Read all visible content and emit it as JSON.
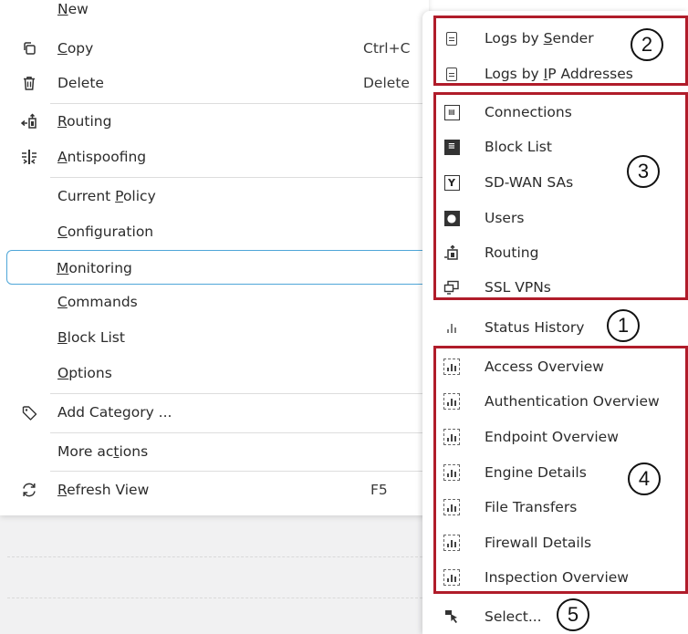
{
  "left_menu": {
    "new": {
      "pre": "",
      "ul": "N",
      "post": "ew"
    },
    "copy": {
      "pre": "",
      "ul": "C",
      "post": "opy",
      "shortcut": "Ctrl+C",
      "icon": "copy-icon"
    },
    "delete": {
      "label": "Delete",
      "shortcut": "Delete",
      "icon": "trash-icon"
    },
    "routing": {
      "pre": "",
      "ul": "R",
      "post": "outing",
      "icon": "routing-icon"
    },
    "antispoofing": {
      "pre": "",
      "ul": "A",
      "post": "ntispoofing",
      "icon": "antispoofing-icon"
    },
    "current_policy": {
      "pre": "Current ",
      "ul": "P",
      "post": "olicy"
    },
    "configuration": {
      "pre": "",
      "ul": "C",
      "post": "onfiguration"
    },
    "monitoring": {
      "pre": "",
      "ul": "M",
      "post": "onitoring"
    },
    "commands": {
      "pre": "",
      "ul": "C",
      "post": "ommands"
    },
    "block_list": {
      "pre": "",
      "ul": "B",
      "post": "lock List"
    },
    "options": {
      "pre": "",
      "ul": "O",
      "post": "ptions"
    },
    "add_category": {
      "label": "Add Category ...",
      "icon": "tag-icon"
    },
    "more_actions": {
      "pre": "More ac",
      "ul": "t",
      "post": "ions"
    },
    "refresh_view": {
      "pre": "",
      "ul": "R",
      "post": "efresh View",
      "shortcut": "F5",
      "icon": "refresh-icon"
    }
  },
  "submenu": {
    "logs_by_sender": {
      "pre": "Logs by ",
      "ul": "S",
      "post": "ender"
    },
    "logs_by_ip": {
      "pre": "Logs by ",
      "ul": "I",
      "post": "P Addresses"
    },
    "connections": "Connections",
    "block_list": "Block List",
    "sdwan_sas": "SD-WAN SAs",
    "users": "Users",
    "routing": "Routing",
    "ssl_vpns": "SSL VPNs",
    "status_history": "Status History",
    "access_overview": "Access Overview",
    "authentication_overview": "Authentication Overview",
    "endpoint_overview": "Endpoint Overview",
    "engine_details": "Engine Details",
    "file_transfers": "File Transfers",
    "firewall_details": "Firewall Details",
    "inspection_overview": "Inspection Overview",
    "select": "Select..."
  },
  "callouts": {
    "n1": "1",
    "n2": "2",
    "n3": "3",
    "n4": "4",
    "n5": "5"
  },
  "colors": {
    "highlight_box": "#b01c2a",
    "selection_border": "#4fa6d8"
  }
}
